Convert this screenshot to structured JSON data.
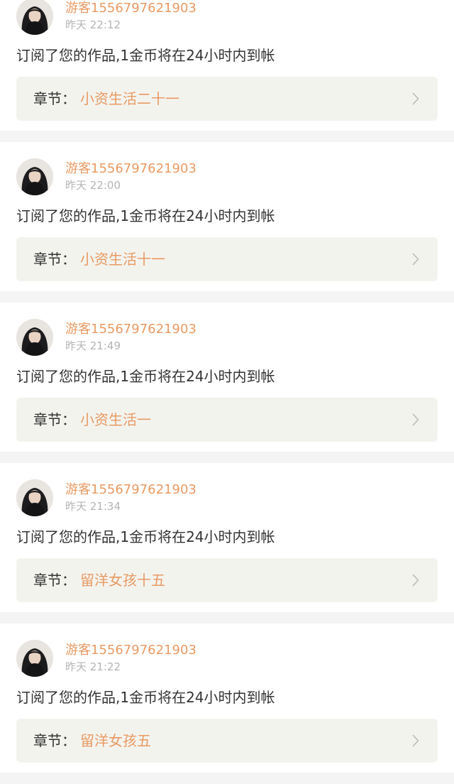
{
  "notifications": [
    {
      "username": "游客1556797621903",
      "time": "昨天 22:12",
      "message": "订阅了您的作品,1金币将在24小时内到帐",
      "chapter_label": "章节：",
      "chapter_title": "小资生活二十一"
    },
    {
      "username": "游客1556797621903",
      "time": "昨天 22:00",
      "message": "订阅了您的作品,1金币将在24小时内到帐",
      "chapter_label": "章节：",
      "chapter_title": "小资生活十一"
    },
    {
      "username": "游客1556797621903",
      "time": "昨天 21:49",
      "message": "订阅了您的作品,1金币将在24小时内到帐",
      "chapter_label": "章节：",
      "chapter_title": "小资生活一"
    },
    {
      "username": "游客1556797621903",
      "time": "昨天 21:34",
      "message": "订阅了您的作品,1金币将在24小时内到帐",
      "chapter_label": "章节：",
      "chapter_title": "留洋女孩十五"
    },
    {
      "username": "游客1556797621903",
      "time": "昨天 21:22",
      "message": "订阅了您的作品,1金币将在24小时内到帐",
      "chapter_label": "章节：",
      "chapter_title": "留洋女孩五"
    }
  ],
  "icons": {
    "avatar": "user-avatar-photo",
    "chevron": "chevron-right-icon"
  },
  "colors": {
    "accent": "#e89a63",
    "text": "#333333",
    "muted": "#b4b4b4",
    "card_bg": "#ffffff",
    "chapter_bg": "#f3f3ee",
    "page_bg": "#f4f4f4"
  }
}
